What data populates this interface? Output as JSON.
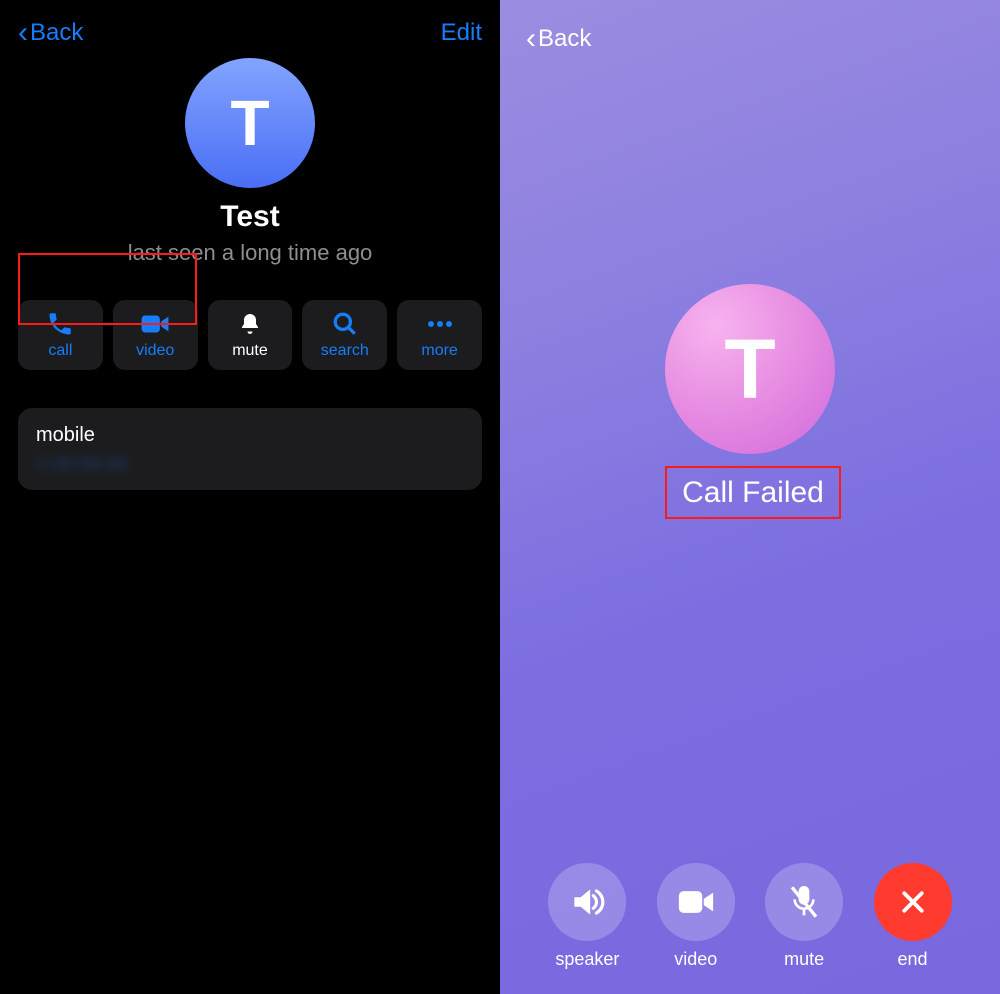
{
  "left": {
    "back_label": "Back",
    "edit_label": "Edit",
    "avatar_initial": "T",
    "contact_name": "Test",
    "status": "last seen a long time ago",
    "actions": [
      {
        "key": "call",
        "label": "call",
        "icon": "phone-icon",
        "color": "blue"
      },
      {
        "key": "video",
        "label": "video",
        "icon": "video-icon",
        "color": "blue"
      },
      {
        "key": "mute",
        "label": "mute",
        "icon": "bell-icon",
        "color": "white"
      },
      {
        "key": "search",
        "label": "search",
        "icon": "search-icon",
        "color": "blue"
      },
      {
        "key": "more",
        "label": "more",
        "icon": "more-icon",
        "color": "blue"
      }
    ],
    "info": {
      "label": "mobile",
      "value": "+ ••• ••• •••"
    }
  },
  "right": {
    "back_label": "Back",
    "avatar_initial": "T",
    "status": "Call Failed",
    "controls": [
      {
        "key": "speaker",
        "label": "speaker",
        "icon": "speaker-icon",
        "style": "translucent"
      },
      {
        "key": "video",
        "label": "video",
        "icon": "video-icon",
        "style": "translucent"
      },
      {
        "key": "mute",
        "label": "mute",
        "icon": "mic-off-icon",
        "style": "translucent"
      },
      {
        "key": "end",
        "label": "end",
        "icon": "close-icon",
        "style": "red"
      }
    ]
  },
  "colors": {
    "ios_blue": "#147efb",
    "red": "#ff3b30",
    "highlight": "#ff1a1a"
  }
}
